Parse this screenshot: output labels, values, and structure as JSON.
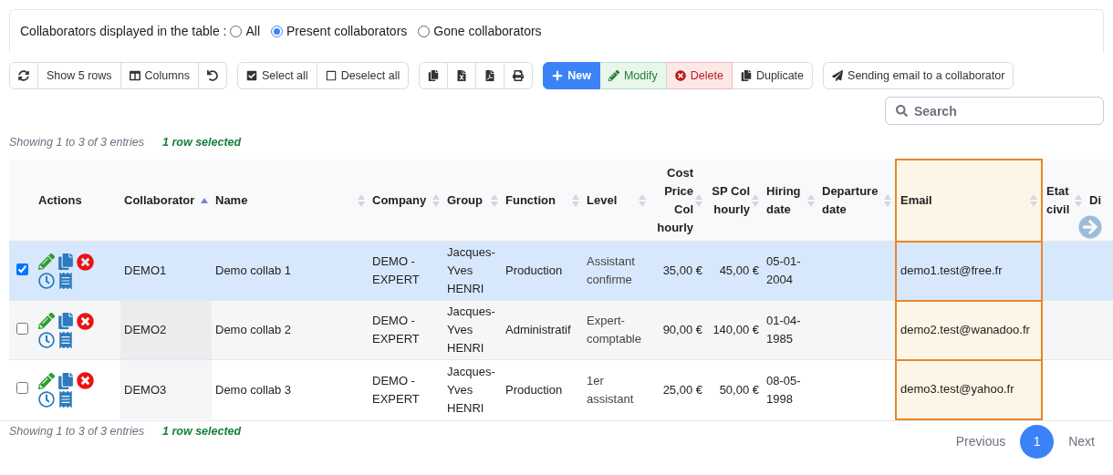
{
  "filter": {
    "label": "Collaborators displayed in the table :",
    "options": [
      {
        "label": "All",
        "selected": false
      },
      {
        "label": "Present collaborators",
        "selected": true
      },
      {
        "label": "Gone collaborators",
        "selected": false
      }
    ]
  },
  "toolbar": [
    [
      {
        "kind": "refresh"
      },
      {
        "kind": "rows",
        "label": "Show 5 rows"
      },
      {
        "kind": "columns",
        "label": "Columns"
      },
      {
        "kind": "reset"
      }
    ],
    [
      {
        "kind": "select-all",
        "label": "Select all"
      },
      {
        "kind": "deselect-all",
        "label": "Deselect all"
      }
    ],
    [
      {
        "kind": "copy"
      },
      {
        "kind": "excel"
      },
      {
        "kind": "pdf"
      },
      {
        "kind": "print"
      }
    ],
    [
      {
        "kind": "new",
        "label": "New"
      },
      {
        "kind": "modify",
        "label": "Modify"
      },
      {
        "kind": "delete",
        "label": "Delete"
      },
      {
        "kind": "duplicate",
        "label": "Duplicate"
      }
    ],
    [
      {
        "kind": "email",
        "label": "Sending email to a collaborator"
      }
    ]
  ],
  "search": {
    "placeholder": "Search"
  },
  "info_top": {
    "entries": "Showing 1 to 3 of 3 entries",
    "selected": "1 row selected"
  },
  "table": {
    "columns": [
      {
        "label": "Actions"
      },
      {
        "label": "Collaborator",
        "sortable": true,
        "sorted": true
      },
      {
        "label": "Name",
        "sortable": true,
        "sorted": false
      },
      {
        "label": "Company",
        "sortable": true,
        "sorted": false
      },
      {
        "label": "Group",
        "sortable": true,
        "sorted": false
      },
      {
        "label": "Function",
        "sortable": true,
        "sorted": false
      },
      {
        "label": "Level",
        "sortable": true,
        "sorted": false
      },
      {
        "label": "Cost Price Col hourly",
        "sortable": true,
        "sorted": false
      },
      {
        "label": "SP Col hourly",
        "sortable": true,
        "sorted": false
      },
      {
        "label": "Hiring date",
        "sortable": true,
        "sorted": false
      },
      {
        "label": "Departure date",
        "sortable": true,
        "sorted": false
      },
      {
        "label": "Email",
        "sortable": true,
        "sorted": false,
        "highlighted": true
      },
      {
        "label": "Etat civil",
        "sortable": true,
        "sorted": false
      },
      {
        "label": "Di"
      }
    ],
    "rows": [
      {
        "selected": true,
        "cells": [
          null,
          "DEMO1",
          "Demo collab 1",
          "DEMO - EXPERT",
          "Jacques-Yves HENRI",
          "Production",
          "Assistant confirme",
          "35,00 €",
          "45,00 €",
          "05-01-2004",
          null,
          "demo1.test@free.fr",
          null,
          null
        ]
      },
      {
        "selected": false,
        "cells": [
          null,
          "DEMO2",
          "Demo collab 2",
          "DEMO - EXPERT",
          "Jacques-Yves HENRI",
          "Administratif",
          "Expert-comptable",
          "90,00 €",
          "140,00 €",
          "01-04-1985",
          null,
          "demo2.test@wanadoo.fr",
          null,
          null
        ]
      },
      {
        "selected": false,
        "cells": [
          null,
          "DEMO3",
          "Demo collab 3",
          "DEMO - EXPERT",
          "Jacques-Yves HENRI",
          "Production",
          "1er assistant",
          "25,00 €",
          "50,00 €",
          "08-05-1998",
          null,
          "demo3.test@yahoo.fr",
          null,
          null
        ]
      }
    ]
  },
  "info_bottom": {
    "entries": "Showing 1 to 3 of 3 entries",
    "selected": "1 row selected"
  },
  "pagination": [
    {
      "label": "Previous",
      "selected": false
    },
    {
      "label": "1",
      "selected": true
    },
    {
      "label": "Next",
      "selected": false
    }
  ]
}
